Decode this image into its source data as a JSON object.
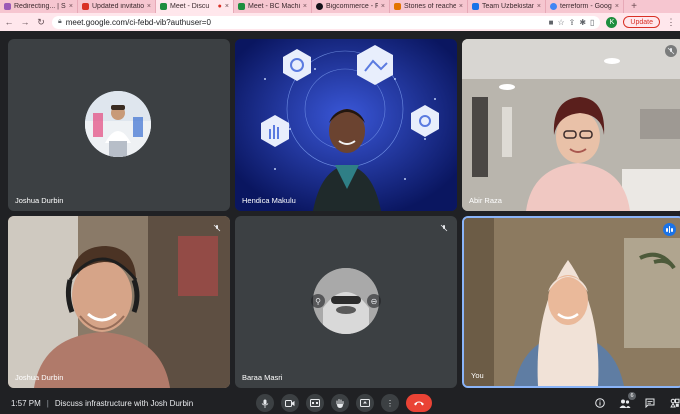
{
  "browser": {
    "tabs": [
      {
        "title": "Redirecting... | Sl",
        "favicon_color": "#9b59b6",
        "active": false
      },
      {
        "title": "Updated invitation",
        "favicon_color": "#d93025",
        "active": false
      },
      {
        "title": "Meet - Discu",
        "favicon_color": "#1e8e3e",
        "active": true
      },
      {
        "title": "Meet - BC Machi",
        "favicon_color": "#1e8e3e",
        "active": false
      },
      {
        "title": "Bigcommerce - F",
        "favicon_color": "#121118",
        "active": false
      },
      {
        "title": "Stories of reache",
        "favicon_color": "#e37400",
        "active": false
      },
      {
        "title": "Team Uzbekistan",
        "favicon_color": "#1a73e8",
        "active": false
      },
      {
        "title": "terreform - Goog",
        "favicon_color": "#4285f4",
        "active": false
      }
    ],
    "new_tab": "+",
    "url": "meet.google.com/ci-febd-vib?authuser=0",
    "profile_initial": "K",
    "update_label": "Update"
  },
  "participants": [
    {
      "name": "Joshua Durbin",
      "muted": false,
      "view": "avatar"
    },
    {
      "name": "Hendica Makulu",
      "muted": false,
      "view": "video"
    },
    {
      "name": "Abir Raza",
      "muted": true,
      "view": "video"
    },
    {
      "name": "Joshua Durbin",
      "muted": true,
      "view": "video"
    },
    {
      "name": "Baraa Masri",
      "muted": true,
      "view": "avatar"
    },
    {
      "name": "You",
      "muted": false,
      "view": "video",
      "speaking": true
    }
  ],
  "meeting": {
    "time": "1:57 PM",
    "separator": "|",
    "title": "Discuss infrastructure with Josh Durbin"
  },
  "controls": {
    "participant_count": "6"
  },
  "colors": {
    "meet_background": "#202124",
    "tile_background": "#3c4043",
    "end_call": "#ea4335",
    "speaking_indicator": "#1a73e8",
    "tab_strip": "#f6c6d0"
  }
}
